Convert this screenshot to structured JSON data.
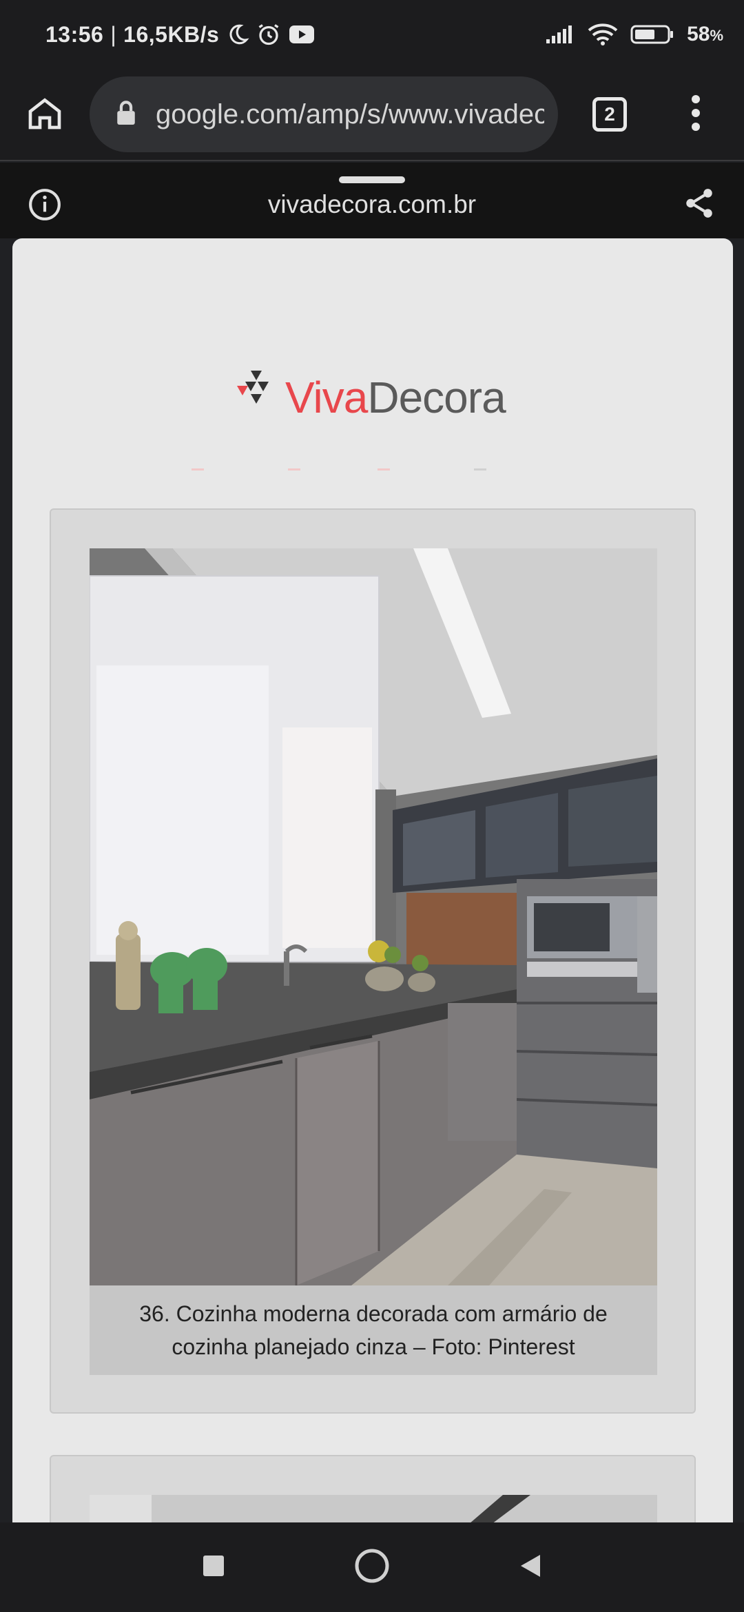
{
  "status_bar": {
    "time": "13:56",
    "separator": "|",
    "network_speed": "16,5KB/s",
    "battery_percent": "58",
    "battery_suffix": "%",
    "icons": [
      "moon-icon",
      "alarm-icon",
      "youtube-icon",
      "signal-icon",
      "wifi-icon",
      "battery-icon"
    ]
  },
  "toolbar": {
    "url": "google.com/amp/s/www.vivadecora.com.br",
    "tab_count": "2",
    "icons": [
      "home-icon",
      "lock-icon",
      "more-vert-icon"
    ]
  },
  "sheet_header": {
    "domain": "vivadecora.com.br",
    "icons": [
      "info-icon",
      "share-icon"
    ]
  },
  "page": {
    "logo": {
      "part1": "Viva",
      "part2": "Decora",
      "colors": {
        "viva": "#e8474c",
        "decora": "#5a5a5a"
      }
    },
    "article_image": {
      "caption": "36. Cozinha moderna decorada com armário de cozinha planejado cinza – Foto: Pinterest"
    }
  },
  "nav_bar": {
    "icons": [
      "recents-square-icon",
      "home-circle-icon",
      "back-triangle-icon"
    ]
  }
}
